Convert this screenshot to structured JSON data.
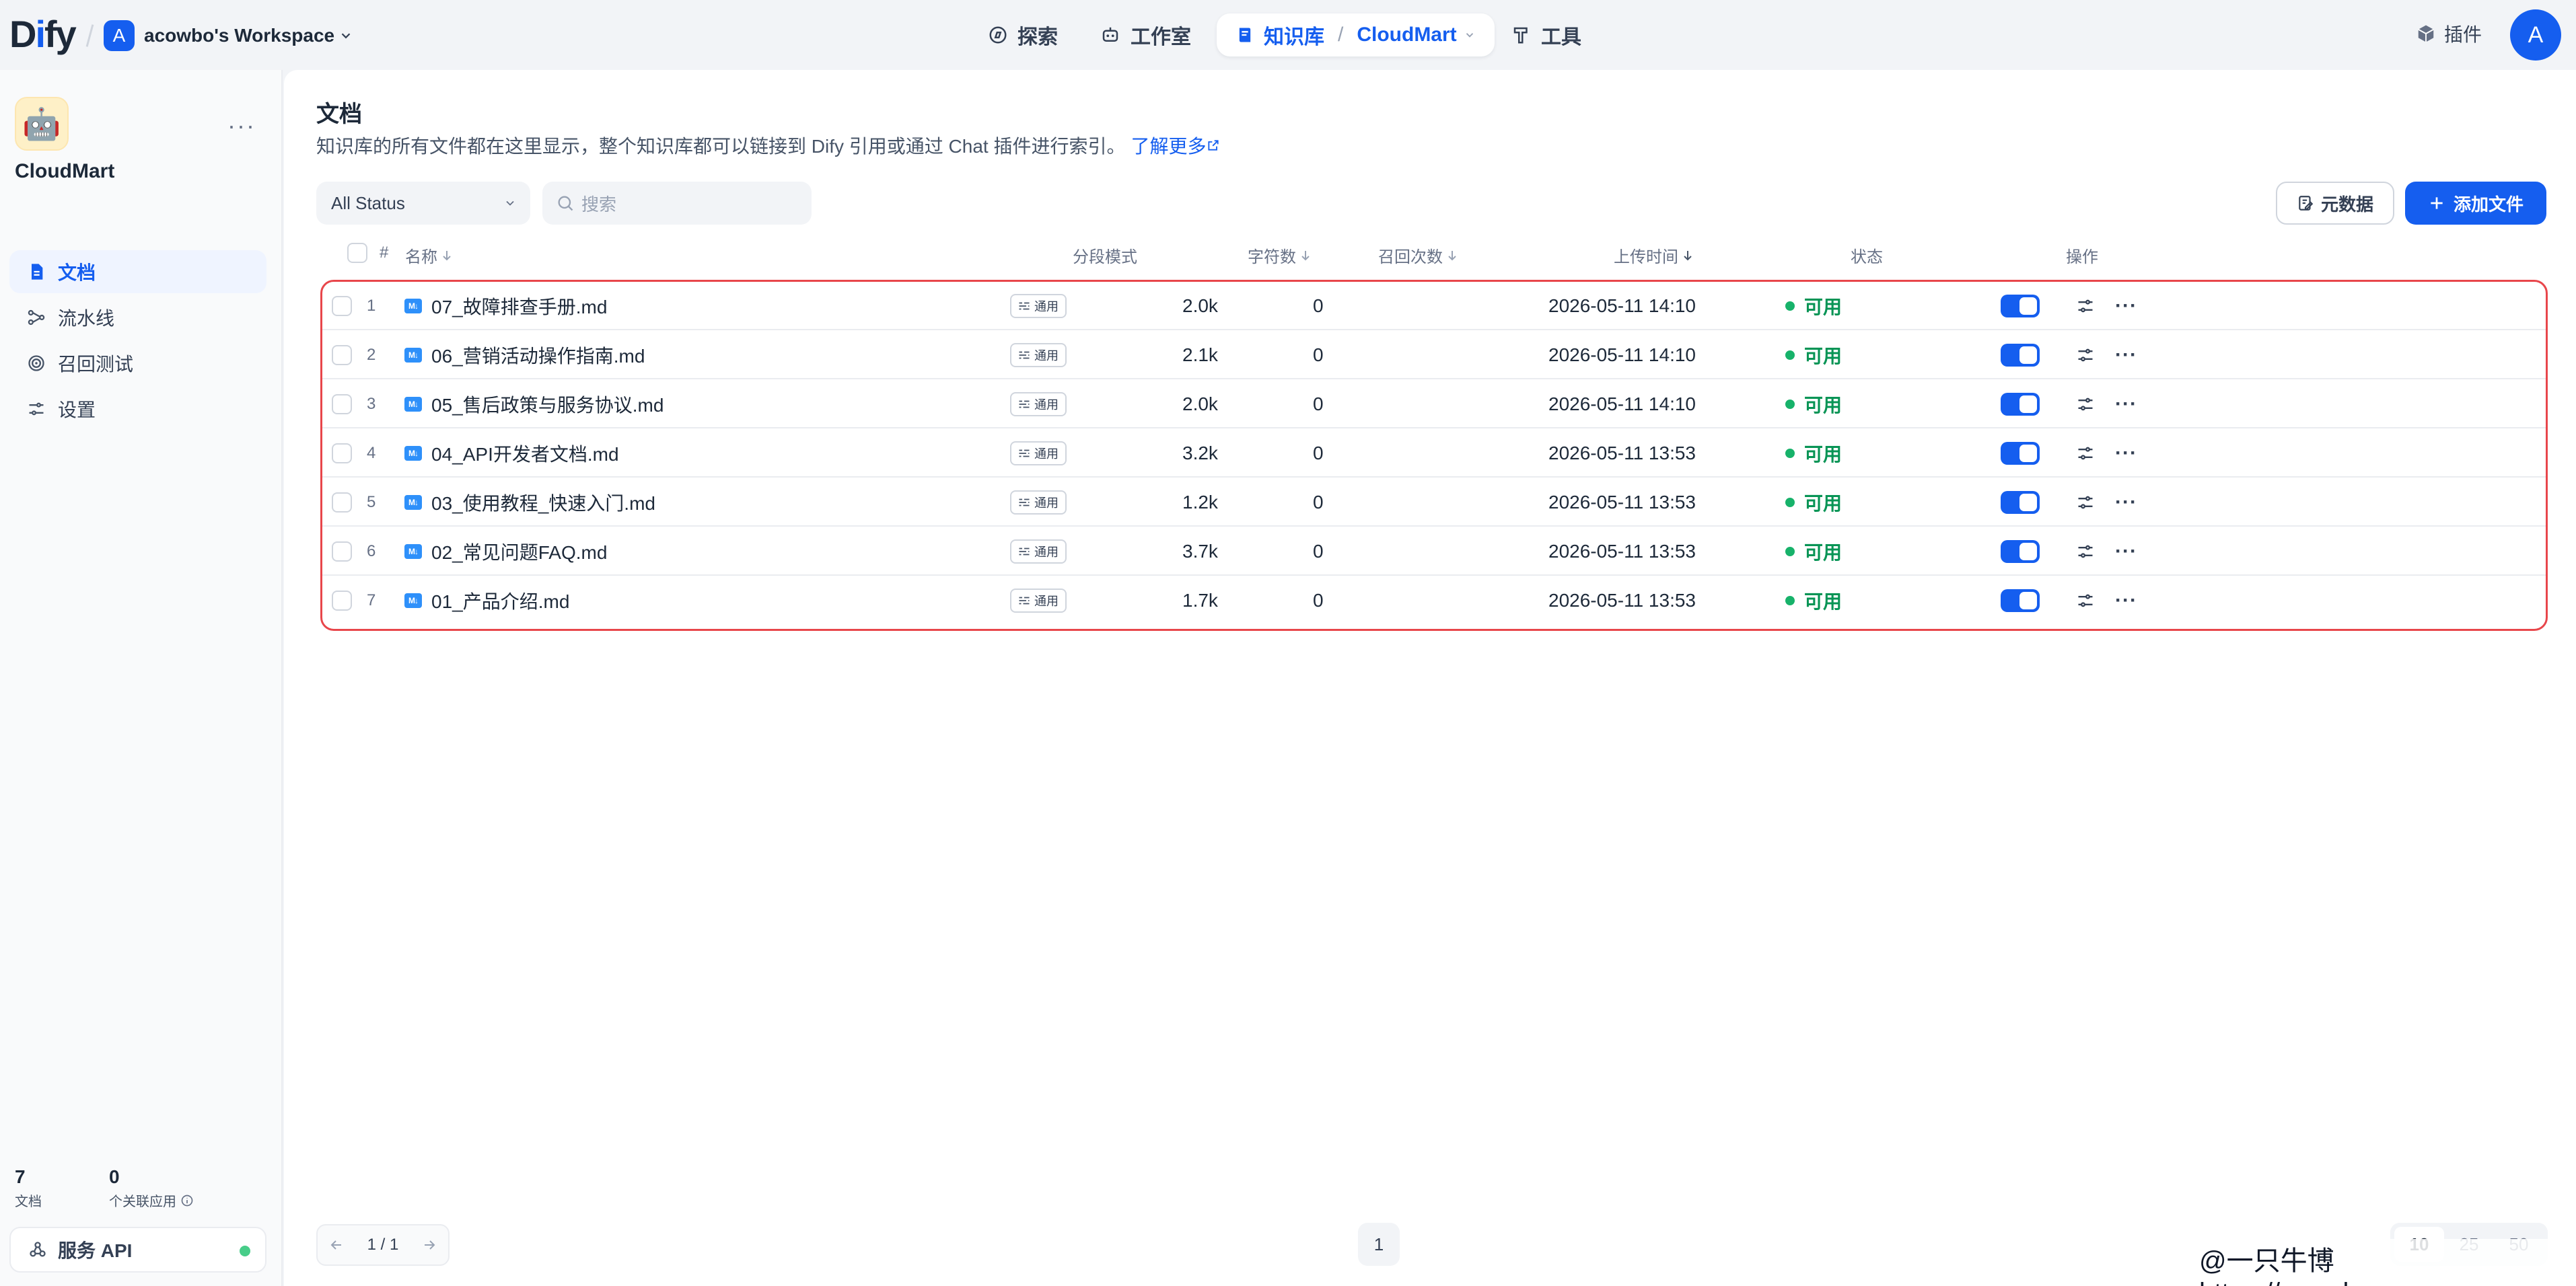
{
  "app": {
    "logo_prefix": "D",
    "logo_i": "i",
    "logo_suffix": "fy"
  },
  "workspace": {
    "avatar": "A",
    "name": "acowbo's Workspace"
  },
  "nav": {
    "explore": "探索",
    "studio": "工作室",
    "knowledge": "知识库",
    "dataset": "CloudMart",
    "tools": "工具"
  },
  "header_right": {
    "plugins": "插件",
    "user_avatar": "A"
  },
  "sidebar": {
    "dataset_name": "CloudMart",
    "dataset_emoji": "🤖",
    "more": "···",
    "items": [
      {
        "label": "文档",
        "icon": "document-icon",
        "active": true
      },
      {
        "label": "流水线",
        "icon": "pipeline-icon",
        "active": false
      },
      {
        "label": "召回测试",
        "icon": "target-icon",
        "active": false
      },
      {
        "label": "设置",
        "icon": "settings-icon",
        "active": false
      }
    ],
    "stats": {
      "doc_count": "7",
      "doc_label": "文档",
      "app_count": "0",
      "app_label": "个关联应用"
    },
    "api": {
      "label": "服务 API",
      "status_color": "#47cd89"
    }
  },
  "main": {
    "title": "文档",
    "description": "知识库的所有文件都在这里显示，整个知识库都可以链接到 Dify 引用或通过 Chat 插件进行索引。",
    "learn_more": "了解更多",
    "filter": {
      "value": "All Status"
    },
    "search": {
      "placeholder": "搜索"
    },
    "metadata_button": "元数据",
    "add_button": "添加文件"
  },
  "table": {
    "columns": {
      "index": "#",
      "name": "名称",
      "mode": "分段模式",
      "words": "字符数",
      "hits": "召回次数",
      "upload_time": "上传时间",
      "status": "状态",
      "actions": "操作"
    },
    "rows": [
      {
        "index": "1",
        "name": "07_故障排查手册.md",
        "mode": "通用",
        "words": "2.0k",
        "hits": "0",
        "upload_time": "2026-05-11 14:10",
        "status": "可用",
        "enabled": true
      },
      {
        "index": "2",
        "name": "06_营销活动操作指南.md",
        "mode": "通用",
        "words": "2.1k",
        "hits": "0",
        "upload_time": "2026-05-11 14:10",
        "status": "可用",
        "enabled": true
      },
      {
        "index": "3",
        "name": "05_售后政策与服务协议.md",
        "mode": "通用",
        "words": "2.0k",
        "hits": "0",
        "upload_time": "2026-05-11 14:10",
        "status": "可用",
        "enabled": true
      },
      {
        "index": "4",
        "name": "04_API开发者文档.md",
        "mode": "通用",
        "words": "3.2k",
        "hits": "0",
        "upload_time": "2026-05-11 13:53",
        "status": "可用",
        "enabled": true
      },
      {
        "index": "5",
        "name": "03_使用教程_快速入门.md",
        "mode": "通用",
        "words": "1.2k",
        "hits": "0",
        "upload_time": "2026-05-11 13:53",
        "status": "可用",
        "enabled": true
      },
      {
        "index": "6",
        "name": "02_常见问题FAQ.md",
        "mode": "通用",
        "words": "3.7k",
        "hits": "0",
        "upload_time": "2026-05-11 13:53",
        "status": "可用",
        "enabled": true
      },
      {
        "index": "7",
        "name": "01_产品介绍.md",
        "mode": "通用",
        "words": "1.7k",
        "hits": "0",
        "upload_time": "2026-05-11 13:53",
        "status": "可用",
        "enabled": true
      }
    ],
    "md_badge": "M↓",
    "more": "···"
  },
  "pagination": {
    "info": "1 / 1",
    "current_page": "1",
    "sizes": [
      "10",
      "25",
      "50"
    ],
    "selected_size": "10"
  },
  "watermark": "@一只牛博 https://acowbo.com",
  "colors": {
    "accent": "#155eef",
    "status_green": "#17b26a",
    "highlight_border": "#e8464b"
  }
}
